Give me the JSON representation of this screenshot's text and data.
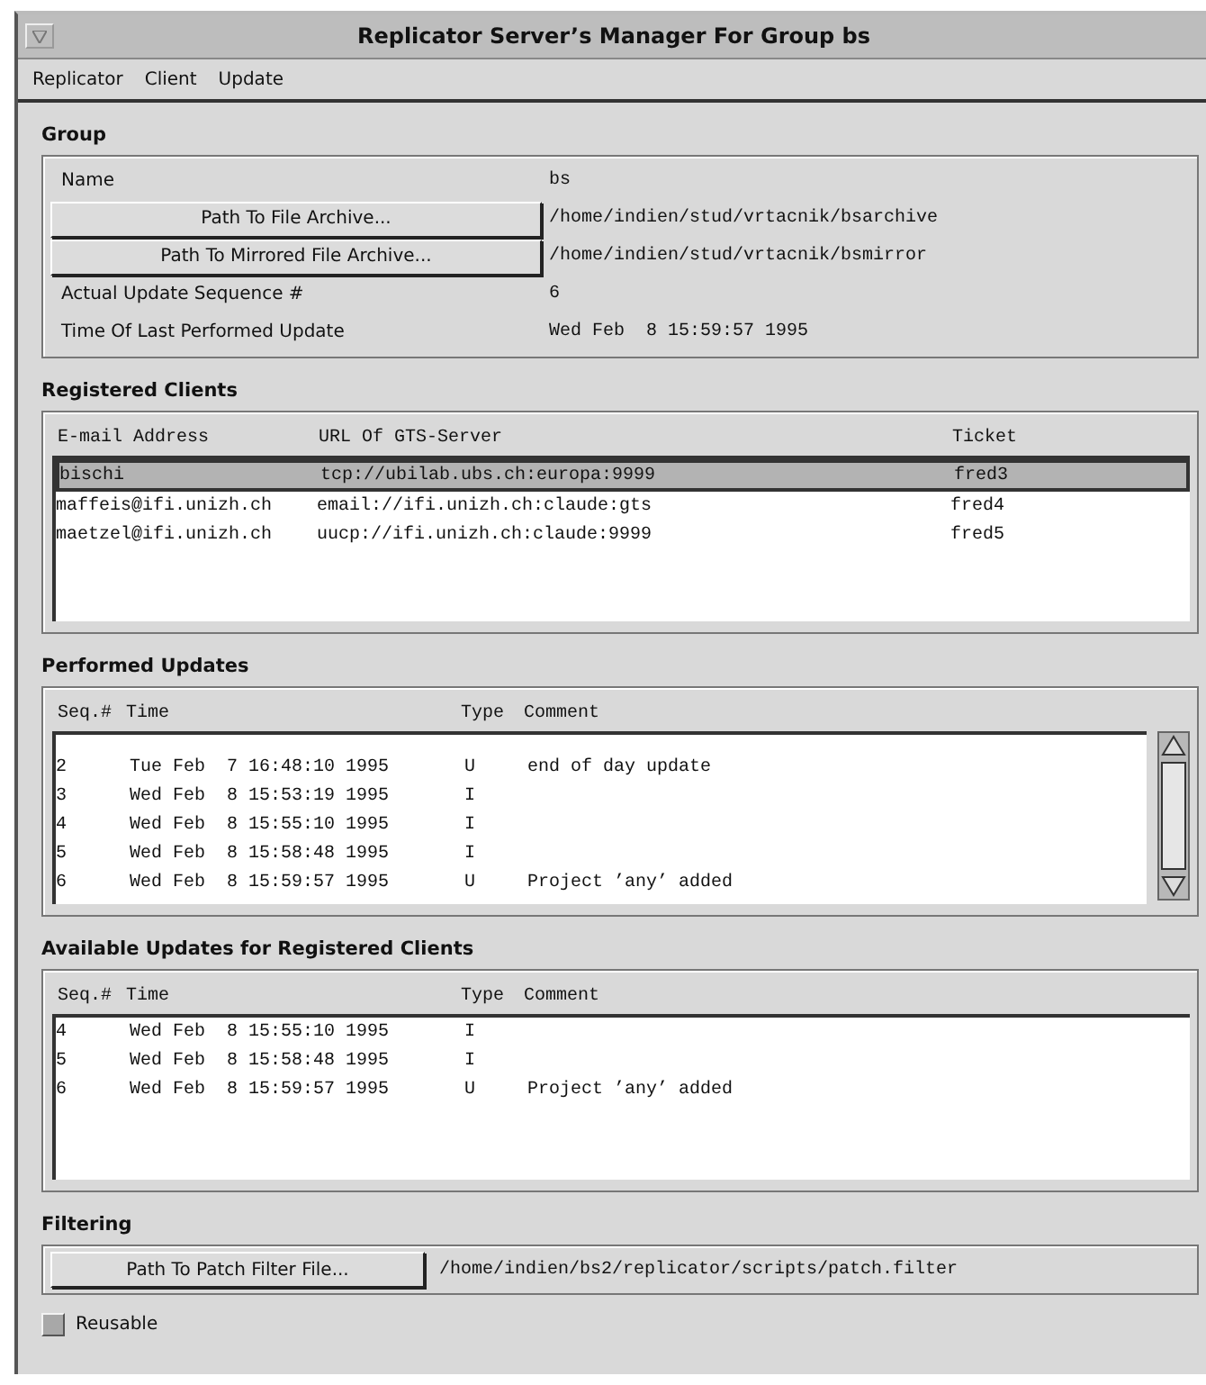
{
  "window": {
    "title": "Replicator Server’s Manager For Group bs"
  },
  "menu": [
    "Replicator",
    "Client",
    "Update"
  ],
  "group": {
    "heading": "Group",
    "fields": [
      {
        "kind": "label",
        "label": "Name",
        "value": "bs"
      },
      {
        "kind": "button",
        "label": "Path To File Archive...",
        "value": "/home/indien/stud/vrtacnik/bsarchive"
      },
      {
        "kind": "button",
        "label": "Path To Mirrored File Archive...",
        "value": "/home/indien/stud/vrtacnik/bsmirror"
      },
      {
        "kind": "label",
        "label": "Actual Update Sequence #",
        "value": "6"
      },
      {
        "kind": "label",
        "label": "Time Of Last Performed Update",
        "value": "Wed Feb  8 15:59:57 1995"
      }
    ]
  },
  "registered_clients": {
    "heading": "Registered Clients",
    "columns": [
      "E-mail Address",
      "URL Of GTS-Server",
      "Ticket"
    ],
    "rows": [
      {
        "cells": [
          "bischi",
          "tcp://ubilab.ubs.ch:europa:9999",
          "fred3"
        ],
        "selected": true
      },
      {
        "cells": [
          "maffeis@ifi.unizh.ch",
          "email://ifi.unizh.ch:claude:gts",
          "fred4"
        ],
        "selected": false
      },
      {
        "cells": [
          "maetzel@ifi.unizh.ch",
          "uucp://ifi.unizh.ch:claude:9999",
          "fred5"
        ],
        "selected": false
      }
    ]
  },
  "performed_updates": {
    "heading": "Performed Updates",
    "columns": [
      "Seq.#",
      "Time",
      "Type",
      "Comment"
    ],
    "rows": [
      {
        "cells": [
          "2",
          "Tue Feb  7 16:48:10 1995",
          "U",
          "end of day update"
        ]
      },
      {
        "cells": [
          "3",
          "Wed Feb  8 15:53:19 1995",
          "I",
          ""
        ]
      },
      {
        "cells": [
          "4",
          "Wed Feb  8 15:55:10 1995",
          "I",
          ""
        ]
      },
      {
        "cells": [
          "5",
          "Wed Feb  8 15:58:48 1995",
          "I",
          ""
        ]
      },
      {
        "cells": [
          "6",
          "Wed Feb  8 15:59:57 1995",
          "U",
          "Project ’any’ added"
        ]
      }
    ]
  },
  "available_updates": {
    "heading": "Available Updates for Registered Clients",
    "columns": [
      "Seq.#",
      "Time",
      "Type",
      "Comment"
    ],
    "rows": [
      {
        "cells": [
          "4",
          "Wed Feb  8 15:55:10 1995",
          "I",
          ""
        ]
      },
      {
        "cells": [
          "5",
          "Wed Feb  8 15:58:48 1995",
          "I",
          ""
        ]
      },
      {
        "cells": [
          "6",
          "Wed Feb  8 15:59:57 1995",
          "U",
          "Project ’any’ added"
        ]
      }
    ]
  },
  "filtering": {
    "heading": "Filtering",
    "button": "Path To Patch Filter File...",
    "value": "/home/indien/bs2/replicator/scripts/patch.filter"
  },
  "reusable": {
    "label": "Reusable",
    "checked": false
  }
}
